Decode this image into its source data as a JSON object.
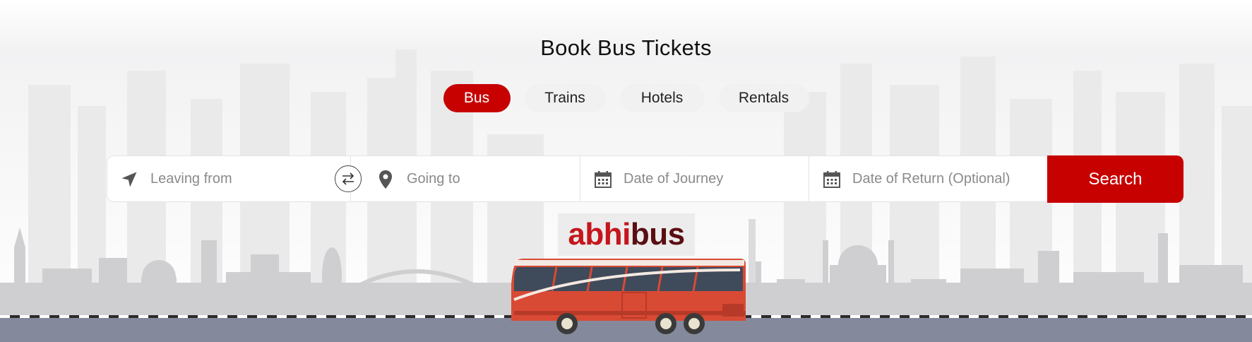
{
  "hero": {
    "title": "Book Bus Tickets"
  },
  "tabs": [
    {
      "label": "Bus",
      "active": true
    },
    {
      "label": "Trains",
      "active": false
    },
    {
      "label": "Hotels",
      "active": false
    },
    {
      "label": "Rentals",
      "active": false
    }
  ],
  "search": {
    "leaving_from": {
      "placeholder": "Leaving from",
      "icon": "navigation-arrow-icon"
    },
    "swap": {
      "icon": "swap-arrows-icon"
    },
    "going_to": {
      "placeholder": "Going to",
      "icon": "location-pin-icon"
    },
    "date_of_journey": {
      "placeholder": "Date of Journey",
      "icon": "calendar-icon"
    },
    "date_of_return": {
      "placeholder": "Date of Return (Optional)",
      "icon": "calendar-icon"
    },
    "button_label": "Search"
  },
  "brand": {
    "logo_part1": "abhi",
    "logo_part2": "bus"
  },
  "colors": {
    "accent": "#c70000",
    "tab_inactive": "#f1f1f1",
    "road": "#848a9c",
    "bus_body": "#d94a35"
  }
}
